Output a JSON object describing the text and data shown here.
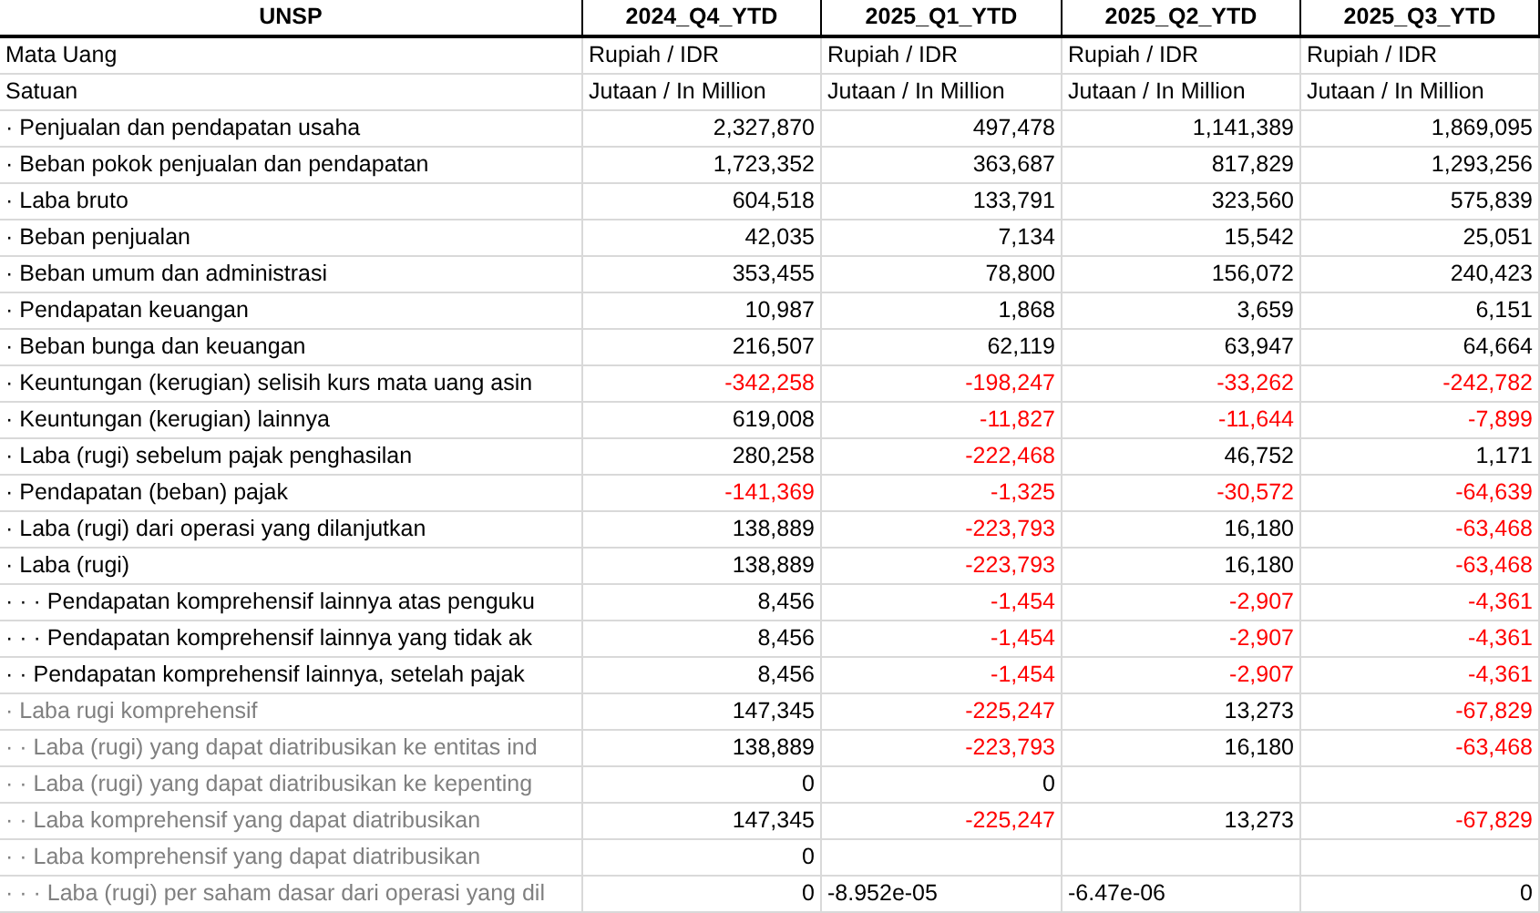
{
  "table": {
    "columns": [
      "UNSP",
      "2024_Q4_YTD",
      "2025_Q1_YTD",
      "2025_Q2_YTD",
      "2025_Q3_YTD"
    ],
    "rows": [
      {
        "label": "Mata Uang",
        "greyed": false,
        "cells": [
          {
            "text": "Rupiah / IDR",
            "kind": "text",
            "negative": false
          },
          {
            "text": "Rupiah / IDR",
            "kind": "text",
            "negative": false
          },
          {
            "text": "Rupiah / IDR",
            "kind": "text",
            "negative": false
          },
          {
            "text": "Rupiah / IDR",
            "kind": "text",
            "negative": false
          }
        ]
      },
      {
        "label": "Satuan",
        "greyed": false,
        "cells": [
          {
            "text": "Jutaan / In Million",
            "kind": "text",
            "negative": false
          },
          {
            "text": "Jutaan / In Million",
            "kind": "text",
            "negative": false
          },
          {
            "text": "Jutaan / In Million",
            "kind": "text",
            "negative": false
          },
          {
            "text": "Jutaan / In Million",
            "kind": "text",
            "negative": false
          }
        ]
      },
      {
        "label": "· Penjualan dan pendapatan usaha",
        "greyed": false,
        "cells": [
          {
            "text": "2,327,870",
            "kind": "number",
            "negative": false
          },
          {
            "text": "497,478",
            "kind": "number",
            "negative": false
          },
          {
            "text": "1,141,389",
            "kind": "number",
            "negative": false
          },
          {
            "text": "1,869,095",
            "kind": "number",
            "negative": false
          }
        ]
      },
      {
        "label": "· Beban pokok penjualan dan pendapatan",
        "greyed": false,
        "cells": [
          {
            "text": "1,723,352",
            "kind": "number",
            "negative": false
          },
          {
            "text": "363,687",
            "kind": "number",
            "negative": false
          },
          {
            "text": "817,829",
            "kind": "number",
            "negative": false
          },
          {
            "text": "1,293,256",
            "kind": "number",
            "negative": false
          }
        ]
      },
      {
        "label": "· Laba bruto",
        "greyed": false,
        "cells": [
          {
            "text": "604,518",
            "kind": "number",
            "negative": false
          },
          {
            "text": "133,791",
            "kind": "number",
            "negative": false
          },
          {
            "text": "323,560",
            "kind": "number",
            "negative": false
          },
          {
            "text": "575,839",
            "kind": "number",
            "negative": false
          }
        ]
      },
      {
        "label": "· Beban penjualan",
        "greyed": false,
        "cells": [
          {
            "text": "42,035",
            "kind": "number",
            "negative": false
          },
          {
            "text": "7,134",
            "kind": "number",
            "negative": false
          },
          {
            "text": "15,542",
            "kind": "number",
            "negative": false
          },
          {
            "text": "25,051",
            "kind": "number",
            "negative": false
          }
        ]
      },
      {
        "label": "· Beban umum dan administrasi",
        "greyed": false,
        "cells": [
          {
            "text": "353,455",
            "kind": "number",
            "negative": false
          },
          {
            "text": "78,800",
            "kind": "number",
            "negative": false
          },
          {
            "text": "156,072",
            "kind": "number",
            "negative": false
          },
          {
            "text": "240,423",
            "kind": "number",
            "negative": false
          }
        ]
      },
      {
        "label": "· Pendapatan keuangan",
        "greyed": false,
        "cells": [
          {
            "text": "10,987",
            "kind": "number",
            "negative": false
          },
          {
            "text": "1,868",
            "kind": "number",
            "negative": false
          },
          {
            "text": "3,659",
            "kind": "number",
            "negative": false
          },
          {
            "text": "6,151",
            "kind": "number",
            "negative": false
          }
        ]
      },
      {
        "label": "· Beban bunga dan keuangan",
        "greyed": false,
        "cells": [
          {
            "text": "216,507",
            "kind": "number",
            "negative": false
          },
          {
            "text": "62,119",
            "kind": "number",
            "negative": false
          },
          {
            "text": "63,947",
            "kind": "number",
            "negative": false
          },
          {
            "text": "64,664",
            "kind": "number",
            "negative": false
          }
        ]
      },
      {
        "label": "· Keuntungan (kerugian) selisih kurs mata uang asin",
        "greyed": false,
        "cells": [
          {
            "text": "-342,258",
            "kind": "number",
            "negative": true
          },
          {
            "text": "-198,247",
            "kind": "number",
            "negative": true
          },
          {
            "text": "-33,262",
            "kind": "number",
            "negative": true
          },
          {
            "text": "-242,782",
            "kind": "number",
            "negative": true
          }
        ]
      },
      {
        "label": "· Keuntungan (kerugian) lainnya",
        "greyed": false,
        "cells": [
          {
            "text": "619,008",
            "kind": "number",
            "negative": false
          },
          {
            "text": "-11,827",
            "kind": "number",
            "negative": true
          },
          {
            "text": "-11,644",
            "kind": "number",
            "negative": true
          },
          {
            "text": "-7,899",
            "kind": "number",
            "negative": true
          }
        ]
      },
      {
        "label": "· Laba (rugi) sebelum pajak penghasilan",
        "greyed": false,
        "cells": [
          {
            "text": "280,258",
            "kind": "number",
            "negative": false
          },
          {
            "text": "-222,468",
            "kind": "number",
            "negative": true
          },
          {
            "text": "46,752",
            "kind": "number",
            "negative": false
          },
          {
            "text": "1,171",
            "kind": "number",
            "negative": false
          }
        ]
      },
      {
        "label": "· Pendapatan (beban) pajak",
        "greyed": false,
        "cells": [
          {
            "text": "-141,369",
            "kind": "number",
            "negative": true
          },
          {
            "text": "-1,325",
            "kind": "number",
            "negative": true
          },
          {
            "text": "-30,572",
            "kind": "number",
            "negative": true
          },
          {
            "text": "-64,639",
            "kind": "number",
            "negative": true
          }
        ]
      },
      {
        "label": "· Laba (rugi) dari operasi yang dilanjutkan",
        "greyed": false,
        "cells": [
          {
            "text": "138,889",
            "kind": "number",
            "negative": false
          },
          {
            "text": "-223,793",
            "kind": "number",
            "negative": true
          },
          {
            "text": "16,180",
            "kind": "number",
            "negative": false
          },
          {
            "text": "-63,468",
            "kind": "number",
            "negative": true
          }
        ]
      },
      {
        "label": "· Laba (rugi)",
        "greyed": false,
        "cells": [
          {
            "text": "138,889",
            "kind": "number",
            "negative": false
          },
          {
            "text": "-223,793",
            "kind": "number",
            "negative": true
          },
          {
            "text": "16,180",
            "kind": "number",
            "negative": false
          },
          {
            "text": "-63,468",
            "kind": "number",
            "negative": true
          }
        ]
      },
      {
        "label": "· · · Pendapatan komprehensif lainnya atas penguku",
        "greyed": false,
        "cells": [
          {
            "text": "8,456",
            "kind": "number",
            "negative": false
          },
          {
            "text": "-1,454",
            "kind": "number",
            "negative": true
          },
          {
            "text": "-2,907",
            "kind": "number",
            "negative": true
          },
          {
            "text": "-4,361",
            "kind": "number",
            "negative": true
          }
        ]
      },
      {
        "label": "· · · Pendapatan komprehensif lainnya yang tidak ak",
        "greyed": false,
        "cells": [
          {
            "text": "8,456",
            "kind": "number",
            "negative": false
          },
          {
            "text": "-1,454",
            "kind": "number",
            "negative": true
          },
          {
            "text": "-2,907",
            "kind": "number",
            "negative": true
          },
          {
            "text": "-4,361",
            "kind": "number",
            "negative": true
          }
        ]
      },
      {
        "label": "· · Pendapatan komprehensif lainnya, setelah pajak",
        "greyed": false,
        "cells": [
          {
            "text": "8,456",
            "kind": "number",
            "negative": false
          },
          {
            "text": "-1,454",
            "kind": "number",
            "negative": true
          },
          {
            "text": "-2,907",
            "kind": "number",
            "negative": true
          },
          {
            "text": "-4,361",
            "kind": "number",
            "negative": true
          }
        ]
      },
      {
        "label": "· Laba rugi komprehensif",
        "greyed": true,
        "cells": [
          {
            "text": "147,345",
            "kind": "number",
            "negative": false
          },
          {
            "text": "-225,247",
            "kind": "number",
            "negative": true
          },
          {
            "text": "13,273",
            "kind": "number",
            "negative": false
          },
          {
            "text": "-67,829",
            "kind": "number",
            "negative": true
          }
        ]
      },
      {
        "label": "· · Laba (rugi) yang dapat diatribusikan ke entitas ind",
        "greyed": true,
        "cells": [
          {
            "text": "138,889",
            "kind": "number",
            "negative": false
          },
          {
            "text": "-223,793",
            "kind": "number",
            "negative": true
          },
          {
            "text": "16,180",
            "kind": "number",
            "negative": false
          },
          {
            "text": "-63,468",
            "kind": "number",
            "negative": true
          }
        ]
      },
      {
        "label": "· · Laba (rugi) yang dapat diatribusikan ke kepenting",
        "greyed": true,
        "cells": [
          {
            "text": "0",
            "kind": "number",
            "negative": false
          },
          {
            "text": "0",
            "kind": "number",
            "negative": false
          },
          null,
          null
        ]
      },
      {
        "label": "· · Laba komprehensif yang dapat diatribusikan",
        "greyed": true,
        "cells": [
          {
            "text": "147,345",
            "kind": "number",
            "negative": false
          },
          {
            "text": "-225,247",
            "kind": "number",
            "negative": true
          },
          {
            "text": "13,273",
            "kind": "number",
            "negative": false
          },
          {
            "text": "-67,829",
            "kind": "number",
            "negative": true
          }
        ]
      },
      {
        "label": "· · Laba komprehensif yang dapat diatribusikan",
        "greyed": true,
        "cells": [
          {
            "text": "0",
            "kind": "number",
            "negative": false
          },
          null,
          null,
          null
        ]
      },
      {
        "label": "· · · Laba (rugi) per saham dasar dari operasi yang dil",
        "greyed": true,
        "cells": [
          {
            "text": "0",
            "kind": "number",
            "negative": false
          },
          {
            "text": "-8.952e-05",
            "kind": "text",
            "negative": false
          },
          {
            "text": "-6.47e-06",
            "kind": "text",
            "negative": false
          },
          {
            "text": "0",
            "kind": "number",
            "negative": false
          }
        ]
      }
    ]
  }
}
